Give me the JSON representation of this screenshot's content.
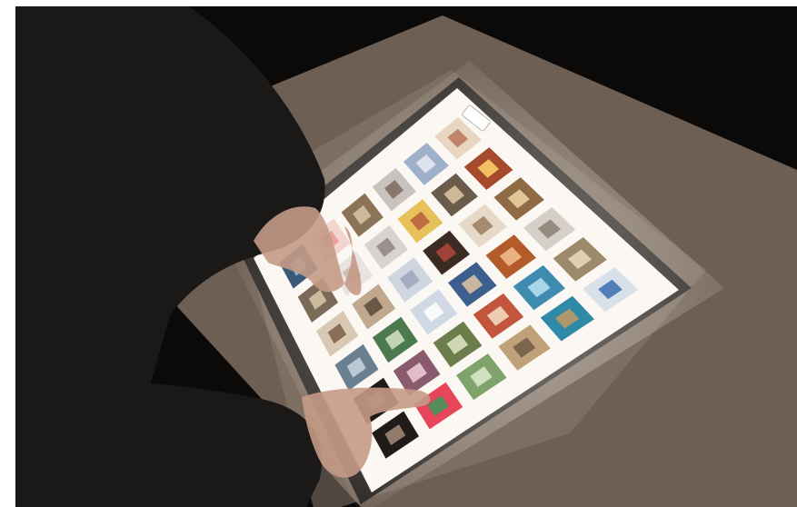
{
  "photo": {
    "subject": "",
    "table_button_label": "",
    "colors": {
      "background": "#0b0a09",
      "table_body": "#6e5f54",
      "table_top": "#8a7a6d",
      "bezel": "#2a2623",
      "screen": "#fbf7f3",
      "skin": "#c49a86",
      "sleeve": "#1a1918"
    },
    "tiles": [
      {
        "color": "#3a5a78",
        "accent": "#9ec2d8"
      },
      {
        "color": "#f2d5cf",
        "accent": "#e79a8e"
      },
      {
        "color": "#8b7358",
        "accent": "#d9c6a4"
      },
      {
        "color": "#c9c2bd",
        "accent": "#7d6a5f"
      },
      {
        "color": "#9fb0c9",
        "accent": "#e8ecf5"
      },
      {
        "color": "#e9d6c0",
        "accent": "#b7765a"
      },
      {
        "color": "#7a6a58",
        "accent": "#d8c8a8"
      },
      {
        "color": "#e8e3e0",
        "accent": "#c7b6ad"
      },
      {
        "color": "#d9d3cf",
        "accent": "#8e8480"
      },
      {
        "color": "#e7c15a",
        "accent": "#b85d3c"
      },
      {
        "color": "#6b5b4a",
        "accent": "#e1c9a1"
      },
      {
        "color": "#a64a2e",
        "accent": "#ffd36b"
      },
      {
        "color": "#d9c8b4",
        "accent": "#7a5d45"
      },
      {
        "color": "#bfa88d",
        "accent": "#5b4a3a"
      },
      {
        "color": "#cfd6e0",
        "accent": "#9aa6b8"
      },
      {
        "color": "#3b2b22",
        "accent": "#b1453c"
      },
      {
        "color": "#e6d9c7",
        "accent": "#9a7c5e"
      },
      {
        "color": "#8f6a44",
        "accent": "#f0d6a6"
      },
      {
        "color": "#6a7f90",
        "accent": "#c7d6e2"
      },
      {
        "color": "#4b7a4f",
        "accent": "#d6e3c4"
      },
      {
        "color": "#cfd8e4",
        "accent": "#ffffff"
      },
      {
        "color": "#3c5f8e",
        "accent": "#e3c5a3"
      },
      {
        "color": "#b35b2a",
        "accent": "#f3c28f"
      },
      {
        "color": "#d6cfc7",
        "accent": "#8a7f74"
      },
      {
        "color": "#1f1a18",
        "accent": "#7b5a4a"
      },
      {
        "color": "#8a5b6e",
        "accent": "#f0cfd8"
      },
      {
        "color": "#6b7d4a",
        "accent": "#e0e6c8"
      },
      {
        "color": "#c2553c",
        "accent": "#f4e2c6"
      },
      {
        "color": "#3e8bb0",
        "accent": "#b9e3f2"
      },
      {
        "color": "#9c8a6a",
        "accent": "#e9dcc0"
      },
      {
        "color": "#1e1b19",
        "accent": "#a88c7a"
      },
      {
        "color": "#e6455a",
        "accent": "#3a9a5c"
      },
      {
        "color": "#7fa36b",
        "accent": "#dfeccf"
      },
      {
        "color": "#c0a17a",
        "accent": "#6f5a46"
      },
      {
        "color": "#2f8aa8",
        "accent": "#c79a62"
      },
      {
        "color": "#d8e0ea",
        "accent": "#3a6fb0"
      }
    ]
  }
}
